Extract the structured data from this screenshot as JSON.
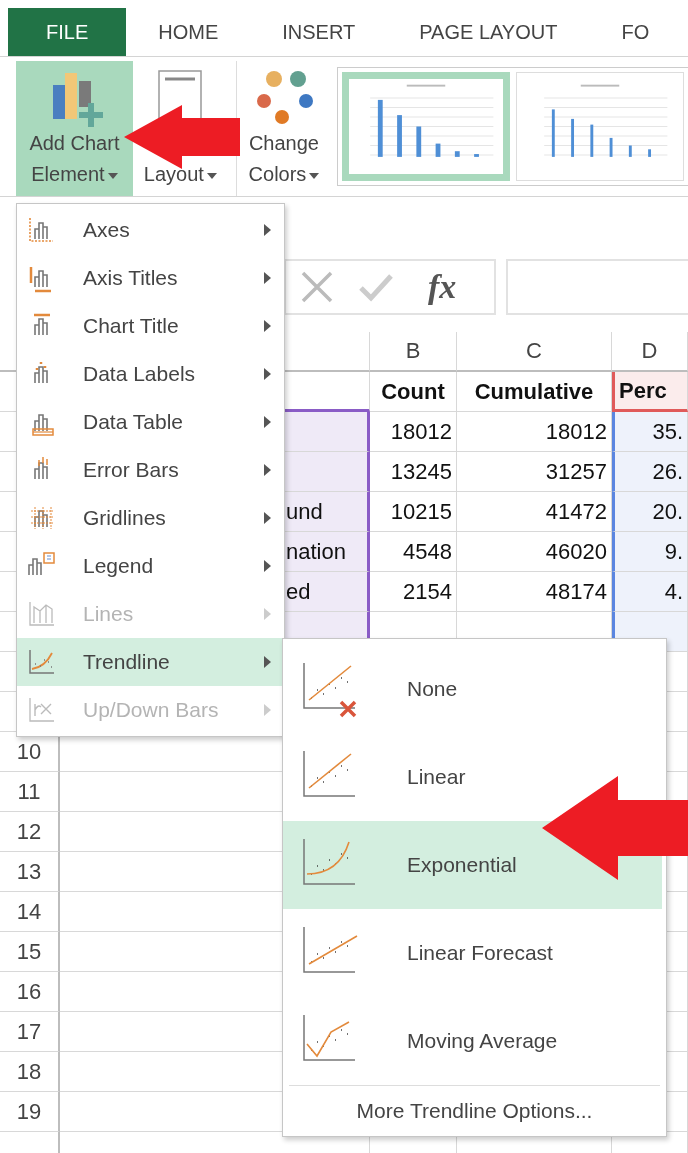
{
  "tabs": [
    {
      "label": "FILE",
      "selected": true
    },
    {
      "label": "HOME",
      "selected": false
    },
    {
      "label": "INSERT",
      "selected": false
    },
    {
      "label": "PAGE LAYOUT",
      "selected": false
    },
    {
      "label": "FO",
      "selected": false
    }
  ],
  "ribbon": {
    "buttons": [
      {
        "kind": "add-chart",
        "lines": [
          "Add Chart",
          "Element"
        ],
        "selected": true
      },
      {
        "kind": "quick-layout",
        "lines": [
          "Layout"
        ],
        "selected": false
      },
      {
        "kind": "colors",
        "lines": [
          "Change",
          "Colors"
        ],
        "selected": false
      }
    ],
    "styles": [
      {
        "selected": true
      },
      {
        "selected": false
      }
    ]
  },
  "formula_bar": {
    "function_label": "fx"
  },
  "sheet": {
    "columns": [
      "B",
      "C",
      "D"
    ],
    "rows": [
      {
        "kind": "header",
        "in_range": false,
        "b": "Count",
        "c": "Cumulative",
        "d": "Perc"
      },
      {
        "kind": "data",
        "in_range": true,
        "b": "18012",
        "c": "18012",
        "d": "35."
      },
      {
        "kind": "data",
        "in_range": true,
        "b": "13245",
        "c": "31257",
        "d": "26."
      },
      {
        "kind": "data",
        "in_range": true,
        "a": "und",
        "b": "10215",
        "c": "41472",
        "d": "20."
      },
      {
        "kind": "data",
        "in_range": true,
        "a": "nation",
        "b": "4548",
        "c": "46020",
        "d": "9."
      },
      {
        "kind": "data",
        "in_range": true,
        "a": "ed",
        "b": "2154",
        "c": "48174",
        "d": "4."
      },
      {
        "kind": "data",
        "in_range": true
      },
      {
        "kind": "data"
      },
      {
        "kind": "data"
      },
      {
        "kind": "data",
        "in_range": false,
        "number": "10"
      },
      {
        "kind": "data",
        "in_range": false,
        "number": "11"
      },
      {
        "kind": "data",
        "in_range": false,
        "number": "12"
      },
      {
        "kind": "data",
        "in_range": false,
        "number": "13"
      },
      {
        "kind": "data",
        "in_range": false,
        "number": "14"
      },
      {
        "kind": "data",
        "in_range": false,
        "number": "15"
      },
      {
        "kind": "data",
        "in_range": false,
        "number": "16"
      },
      {
        "kind": "data",
        "in_range": false,
        "number": "17"
      },
      {
        "kind": "data",
        "in_range": false,
        "number": "18"
      },
      {
        "kind": "data",
        "in_range": false,
        "number": "19"
      },
      {
        "kind": "data",
        "in_range": false
      }
    ]
  },
  "chart_element_menu": {
    "items": [
      {
        "kind": "axes",
        "label": "Axes",
        "disabled": false,
        "selected": false
      },
      {
        "kind": "axis-titles",
        "label": "Axis Titles",
        "disabled": false,
        "selected": false
      },
      {
        "kind": "chart-title",
        "label": "Chart Title",
        "disabled": false,
        "selected": false
      },
      {
        "kind": "data-labels",
        "label": "Data Labels",
        "disabled": false,
        "selected": false
      },
      {
        "kind": "data-table",
        "label": "Data Table",
        "disabled": false,
        "selected": false
      },
      {
        "kind": "error-bars",
        "label": "Error Bars",
        "disabled": false,
        "selected": false
      },
      {
        "kind": "gridlines",
        "label": "Gridlines",
        "disabled": false,
        "selected": false
      },
      {
        "kind": "legend",
        "label": "Legend",
        "disabled": false,
        "selected": false
      },
      {
        "kind": "lines",
        "label": "Lines",
        "disabled": true,
        "selected": false
      },
      {
        "kind": "trendline",
        "label": "Trendline",
        "disabled": false,
        "selected": true
      },
      {
        "kind": "updown",
        "label": "Up/Down Bars",
        "disabled": true,
        "selected": false
      }
    ]
  },
  "trendline_menu": {
    "items": [
      {
        "kind": "none",
        "label": "None",
        "selected": false
      },
      {
        "kind": "linear",
        "label": "Linear",
        "selected": false
      },
      {
        "kind": "exponential",
        "label": "Exponential",
        "selected": true
      },
      {
        "kind": "forecast",
        "label": "Linear Forecast",
        "selected": false
      },
      {
        "kind": "moving-average",
        "label": "Moving Average",
        "selected": false
      }
    ],
    "footer": {
      "label": "More Trendline Options..."
    }
  }
}
